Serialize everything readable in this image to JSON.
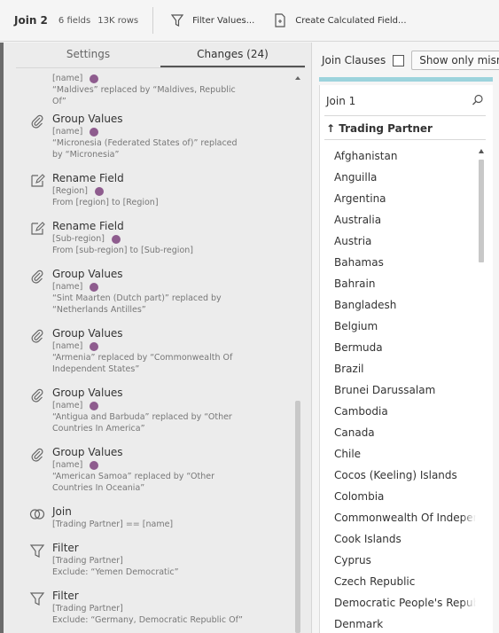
{
  "toolbar": {
    "title": "Join 2",
    "fields": "6 fields",
    "rows": "13K rows",
    "filter_label": "Filter Values...",
    "calc_label": "Create Calculated Field..."
  },
  "tabs": {
    "settings": "Settings",
    "changes": "Changes (24)"
  },
  "changes": [
    {
      "type": "group-values",
      "field": "[name]",
      "desc": "“Maldives” replaced by “Maldives, Republic Of”"
    },
    {
      "type": "group-values",
      "head": "Group Values",
      "field": "[name]",
      "desc": "“Micronesia (Federated States of)” replaced by “Micronesia”"
    },
    {
      "type": "rename",
      "head": "Rename Field",
      "field": "[Region]",
      "desc": "From [region] to [Region]"
    },
    {
      "type": "rename",
      "head": "Rename Field",
      "field": "[Sub-region]",
      "desc": "From [sub-region] to [Sub-region]"
    },
    {
      "type": "group-values",
      "head": "Group Values",
      "field": "[name]",
      "desc": "“Sint Maarten (Dutch part)” replaced by “Netherlands Antilles”"
    },
    {
      "type": "group-values",
      "head": "Group Values",
      "field": "[name]",
      "desc": "“Armenia” replaced by “Commonwealth Of Independent States”"
    },
    {
      "type": "group-values",
      "head": "Group Values",
      "field": "[name]",
      "desc": "“Antigua and Barbuda” replaced by “Other Countries In America”"
    },
    {
      "type": "group-values",
      "head": "Group Values",
      "field": "[name]",
      "desc": "“American Samoa” replaced by “Other Countries In Oceania”"
    },
    {
      "type": "join",
      "head": "Join",
      "field": "[Trading Partner] == [name]"
    },
    {
      "type": "filter",
      "head": "Filter",
      "field": "[Trading Partner]",
      "desc": "Exclude: “Yemen Democratic”"
    },
    {
      "type": "filter",
      "head": "Filter",
      "field": "[Trading Partner]",
      "desc": "Exclude: “Germany, Democratic Republic Of”"
    }
  ],
  "right": {
    "join_clauses_label": "Join Clauses",
    "mismatch_btn": "Show only mismatch",
    "join_name": "Join 1",
    "column_header": "↑ Trading Partner",
    "values": [
      "Afghanistan",
      "Anguilla",
      "Argentina",
      "Australia",
      "Austria",
      "Bahamas",
      "Bahrain",
      "Bangladesh",
      "Belgium",
      "Bermuda",
      "Brazil",
      "Brunei Darussalam",
      "Cambodia",
      "Canada",
      "Chile",
      "Cocos (Keeling) Islands",
      "Colombia",
      "Commonwealth Of Independe",
      "Cook Islands",
      "Cyprus",
      "Czech Republic",
      "Democratic People's Republ",
      "Denmark"
    ]
  },
  "colors": {
    "accent_teal": "#9cd3dc",
    "field_dot": "#8e5c8e"
  }
}
